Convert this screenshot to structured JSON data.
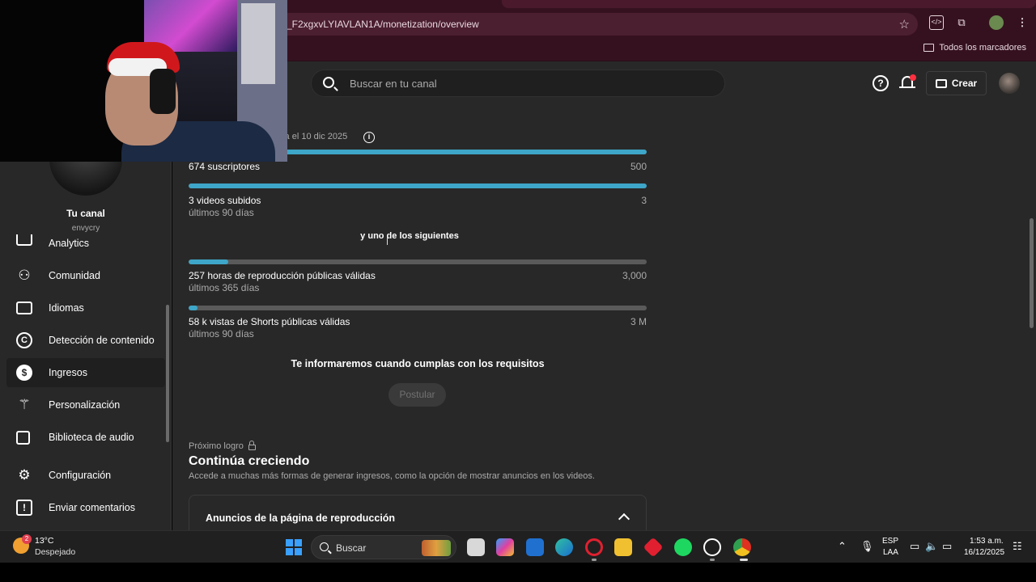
{
  "browser": {
    "url": "_F2xgxvLYIAVLAN1A/monetization/overview",
    "bookmarks_label": "Todos los marcadores"
  },
  "header": {
    "search_placeholder": "Buscar en tu canal",
    "help_glyph": "?",
    "create_label": "Crear"
  },
  "sidebar": {
    "channel_title": "Tu canal",
    "channel_handle": "envycry",
    "items": [
      {
        "label": "Analytics"
      },
      {
        "label": "Comunidad"
      },
      {
        "label": "Idiomas"
      },
      {
        "label": "Detección de contenido"
      },
      {
        "label": "Ingresos",
        "active": true
      },
      {
        "label": "Personalización"
      },
      {
        "label": "Biblioteca de audio"
      },
      {
        "label": "Configuración"
      },
      {
        "label": "Enviar comentarios"
      }
    ]
  },
  "main": {
    "deadline": "sta el 10 dic 2025",
    "requirements": [
      {
        "label": "674 suscriptores",
        "sub": "",
        "target": "500",
        "progress": 1.0
      },
      {
        "label": "3 videos subidos",
        "sub": "últimos 90 días",
        "target": "3",
        "progress": 1.0
      }
    ],
    "one_of_label": "y uno de los siguientes",
    "alternatives": [
      {
        "label": "257 horas de reproducción públicas válidas",
        "sub": "últimos 365 días",
        "target": "3,000",
        "progress": 0.086
      },
      {
        "label": "58 k vistas de Shorts públicas válidas",
        "sub": "últimos 90 días",
        "target": "3 M",
        "progress": 0.019
      }
    ],
    "notify_text": "Te informaremos cuando cumplas con los requisitos",
    "apply_label": "Postular",
    "next_label": "Próximo logro",
    "grow_title": "Continúa creciendo",
    "grow_desc": "Accede a muchas más formas de generar ingresos, como la opción de mostrar anuncios en los videos.",
    "ads_card_title": "Anuncios de la página de reproducción"
  },
  "taskbar": {
    "weather_badge": "2",
    "weather_temp": "13°C",
    "weather_desc": "Despejado",
    "search_label": "Buscar",
    "lang_top": "ESP",
    "lang_bottom": "LAA",
    "time": "1:53 a.m.",
    "date": "16/12/2025"
  },
  "colors": {
    "progress_fill": "#3ea6c8",
    "progress_track": "#5a5a5a",
    "studio_bg": "#282828",
    "chrome_bg": "#35111f"
  }
}
